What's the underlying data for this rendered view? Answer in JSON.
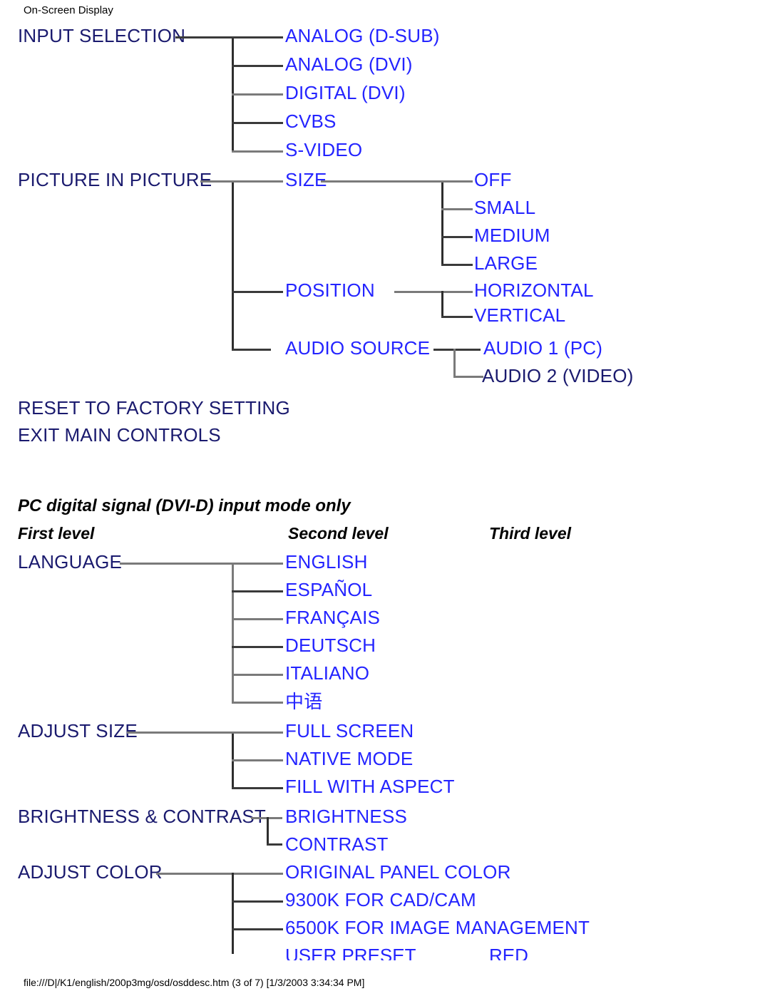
{
  "page": {
    "header": "On-Screen Display",
    "footer": "file:///D|/K1/english/200p3mg/osd/osddesc.htm (3 of 7) [1/3/2003 3:34:34 PM]",
    "colors": {
      "first_level": "#1a1a6e",
      "second_level": "#2424ff",
      "third_level": "#2424ff",
      "line": "#3a3a3a",
      "line_gray": "#7a7a7a",
      "background": "#ffffff"
    }
  },
  "tree_top": {
    "input_selection": {
      "label": "INPUT SELECTION",
      "children": [
        "ANALOG (D-SUB)",
        "ANALOG (DVI)",
        "DIGITAL (DVI)",
        "CVBS",
        "S-VIDEO"
      ]
    },
    "picture_in_picture": {
      "label": "PICTURE IN PICTURE",
      "children": [
        {
          "label": "SIZE",
          "children": [
            "OFF",
            "SMALL",
            "MEDIUM",
            "LARGE"
          ]
        },
        {
          "label": "POSITION",
          "children": [
            "HORIZONTAL",
            "VERTICAL"
          ]
        },
        {
          "label": "AUDIO SOURCE",
          "children": [
            "AUDIO 1 (PC)",
            "AUDIO 2 (VIDEO)"
          ]
        }
      ]
    },
    "standalone": [
      "RESET TO FACTORY SETTING",
      "EXIT MAIN CONTROLS"
    ]
  },
  "section2": {
    "note": "PC digital signal (DVI-D) input mode only",
    "columns": {
      "first": "First level",
      "second": "Second level",
      "third": "Third level"
    },
    "language": {
      "label": "LANGUAGE",
      "children": [
        "ENGLISH",
        "ESPAÑOL",
        "FRANÇAIS",
        "DEUTSCH",
        "ITALIANO",
        "中语"
      ]
    },
    "adjust_size": {
      "label": "ADJUST SIZE",
      "children": [
        "FULL SCREEN",
        "NATIVE MODE",
        "FILL WITH ASPECT"
      ]
    },
    "brightness_contrast": {
      "label": "BRIGHTNESS & CONTRAST",
      "children": [
        "BRIGHTNESS",
        "CONTRAST"
      ]
    },
    "adjust_color": {
      "label": "ADJUST COLOR",
      "children": [
        "ORIGINAL PANEL COLOR",
        "9300K FOR CAD/CAM",
        "6500K FOR IMAGE MANAGEMENT",
        "USER PRESET"
      ],
      "clipped_third": "RED"
    }
  }
}
